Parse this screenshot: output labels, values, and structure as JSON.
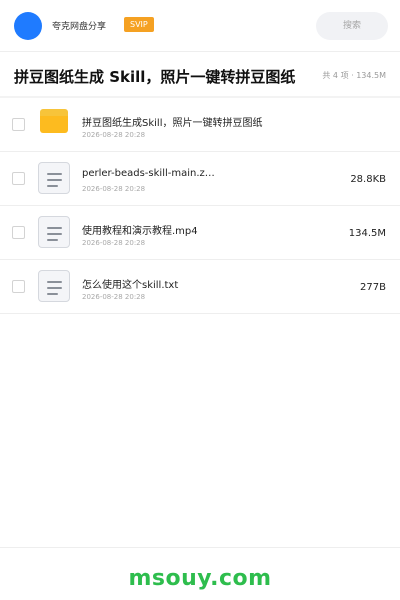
{
  "header": {
    "app_name": "夸克网盘分享",
    "badge": "SVIP",
    "search_label": "搜索",
    "colors": {
      "avatar": "#1f7bff",
      "badge": "#f5a122"
    }
  },
  "share": {
    "title": "拼豆图纸生成 Skill，照片一键转拼豆图纸",
    "summary": "共 4 项 · 134.5M"
  },
  "files": [
    {
      "name": "拼豆图纸生成Skill，照片一键转拼豆图纸",
      "date": "2026-08-28 20:28",
      "size": "",
      "icon": "folder-icon"
    },
    {
      "name": "perler-beads-skill-main.z…",
      "date": "2026-08-28 20:28",
      "size": "28.8KB",
      "icon": "file-icon"
    },
    {
      "name": "使用教程和演示教程.mp4",
      "date": "2026-08-28 20:28",
      "size": "134.5M",
      "icon": "file-icon"
    },
    {
      "name": "怎么使用这个skill.txt",
      "date": "2026-08-28 20:28",
      "size": "277B",
      "icon": "file-icon"
    }
  ],
  "watermark": {
    "text": "msouy.com",
    "color": "#2ebd4d"
  }
}
